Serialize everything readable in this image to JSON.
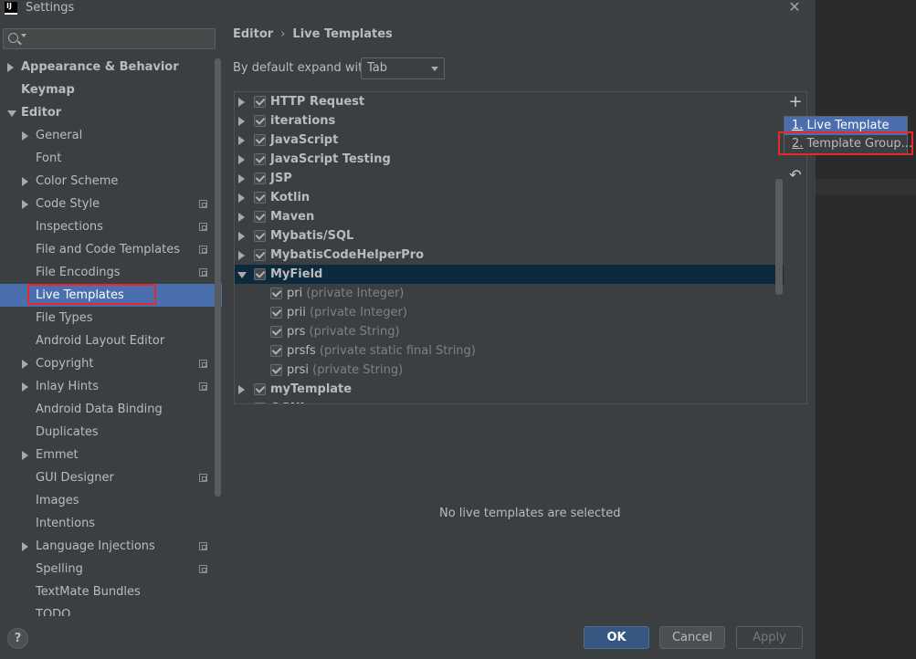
{
  "window": {
    "title": "Settings",
    "app_icon_text": "IJ"
  },
  "search": {
    "placeholder": ""
  },
  "sidebar": {
    "items": [
      {
        "label": "Appearance & Behavior",
        "level": 0,
        "arrow": "right",
        "bold": true,
        "badge": false,
        "selected": false
      },
      {
        "label": "Keymap",
        "level": 0,
        "arrow": "none",
        "bold": true,
        "badge": false,
        "selected": false
      },
      {
        "label": "Editor",
        "level": 0,
        "arrow": "down",
        "bold": true,
        "badge": false,
        "selected": false
      },
      {
        "label": "General",
        "level": 1,
        "arrow": "right",
        "bold": false,
        "badge": false,
        "selected": false
      },
      {
        "label": "Font",
        "level": 1,
        "arrow": "none",
        "bold": false,
        "badge": false,
        "selected": false
      },
      {
        "label": "Color Scheme",
        "level": 1,
        "arrow": "right",
        "bold": false,
        "badge": false,
        "selected": false
      },
      {
        "label": "Code Style",
        "level": 1,
        "arrow": "right",
        "bold": false,
        "badge": true,
        "selected": false
      },
      {
        "label": "Inspections",
        "level": 1,
        "arrow": "none",
        "bold": false,
        "badge": true,
        "selected": false
      },
      {
        "label": "File and Code Templates",
        "level": 1,
        "arrow": "none",
        "bold": false,
        "badge": true,
        "selected": false
      },
      {
        "label": "File Encodings",
        "level": 1,
        "arrow": "none",
        "bold": false,
        "badge": true,
        "selected": false
      },
      {
        "label": "Live Templates",
        "level": 1,
        "arrow": "none",
        "bold": false,
        "badge": false,
        "selected": true
      },
      {
        "label": "File Types",
        "level": 1,
        "arrow": "none",
        "bold": false,
        "badge": false,
        "selected": false
      },
      {
        "label": "Android Layout Editor",
        "level": 1,
        "arrow": "none",
        "bold": false,
        "badge": false,
        "selected": false
      },
      {
        "label": "Copyright",
        "level": 1,
        "arrow": "right",
        "bold": false,
        "badge": true,
        "selected": false
      },
      {
        "label": "Inlay Hints",
        "level": 1,
        "arrow": "right",
        "bold": false,
        "badge": true,
        "selected": false
      },
      {
        "label": "Android Data Binding",
        "level": 1,
        "arrow": "none",
        "bold": false,
        "badge": false,
        "selected": false
      },
      {
        "label": "Duplicates",
        "level": 1,
        "arrow": "none",
        "bold": false,
        "badge": false,
        "selected": false
      },
      {
        "label": "Emmet",
        "level": 1,
        "arrow": "right",
        "bold": false,
        "badge": false,
        "selected": false
      },
      {
        "label": "GUI Designer",
        "level": 1,
        "arrow": "none",
        "bold": false,
        "badge": true,
        "selected": false
      },
      {
        "label": "Images",
        "level": 1,
        "arrow": "none",
        "bold": false,
        "badge": false,
        "selected": false
      },
      {
        "label": "Intentions",
        "level": 1,
        "arrow": "none",
        "bold": false,
        "badge": false,
        "selected": false
      },
      {
        "label": "Language Injections",
        "level": 1,
        "arrow": "right",
        "bold": false,
        "badge": true,
        "selected": false
      },
      {
        "label": "Spelling",
        "level": 1,
        "arrow": "none",
        "bold": false,
        "badge": true,
        "selected": false
      },
      {
        "label": "TextMate Bundles",
        "level": 1,
        "arrow": "none",
        "bold": false,
        "badge": false,
        "selected": false
      },
      {
        "label": "TODO",
        "level": 1,
        "arrow": "none",
        "bold": false,
        "badge": false,
        "selected": false
      }
    ]
  },
  "breadcrumb": {
    "parent": "Editor",
    "separator": "›",
    "current": "Live Templates"
  },
  "expand": {
    "label": "By default expand with",
    "value": "Tab"
  },
  "tree": {
    "groups": [
      {
        "name": "HTTP Request",
        "expanded": false,
        "checked": true,
        "children": []
      },
      {
        "name": "iterations",
        "expanded": false,
        "checked": true,
        "children": []
      },
      {
        "name": "JavaScript",
        "expanded": false,
        "checked": true,
        "children": []
      },
      {
        "name": "JavaScript Testing",
        "expanded": false,
        "checked": true,
        "children": []
      },
      {
        "name": "JSP",
        "expanded": false,
        "checked": true,
        "children": []
      },
      {
        "name": "Kotlin",
        "expanded": false,
        "checked": true,
        "children": []
      },
      {
        "name": "Maven",
        "expanded": false,
        "checked": true,
        "children": []
      },
      {
        "name": "Mybatis/SQL",
        "expanded": false,
        "checked": true,
        "children": []
      },
      {
        "name": "MybatisCodeHelperPro",
        "expanded": false,
        "checked": true,
        "children": []
      },
      {
        "name": "MyField",
        "expanded": true,
        "checked": true,
        "selected": true,
        "children": [
          {
            "abbr": "pri",
            "desc": "(private Integer)",
            "checked": true
          },
          {
            "abbr": "prii",
            "desc": "(private Integer)",
            "checked": true
          },
          {
            "abbr": "prs",
            "desc": "(private String)",
            "checked": true
          },
          {
            "abbr": "prsfs",
            "desc": "(private static final String)",
            "checked": true
          },
          {
            "abbr": "prsi",
            "desc": "(private String)",
            "checked": true
          }
        ]
      },
      {
        "name": "myTemplate",
        "expanded": false,
        "checked": true,
        "children": []
      },
      {
        "name": "OGNL",
        "expanded": false,
        "checked": true,
        "children": []
      }
    ]
  },
  "toolbar": {
    "add_symbol": "+",
    "restore_symbol": "↶"
  },
  "popup": {
    "items": [
      {
        "mnemonic": "1.",
        "label": "Live Template",
        "active": true
      },
      {
        "mnemonic": "2.",
        "label": "Template Group...",
        "active": false
      }
    ]
  },
  "empty_message": "No live templates are selected",
  "buttons": {
    "help": "?",
    "ok": "OK",
    "cancel": "Cancel",
    "apply": "Apply"
  },
  "colors": {
    "selection": "#4b6eaf",
    "tree_selection": "#0d293e",
    "highlight": "#e8282b",
    "background": "#3c3f41"
  }
}
